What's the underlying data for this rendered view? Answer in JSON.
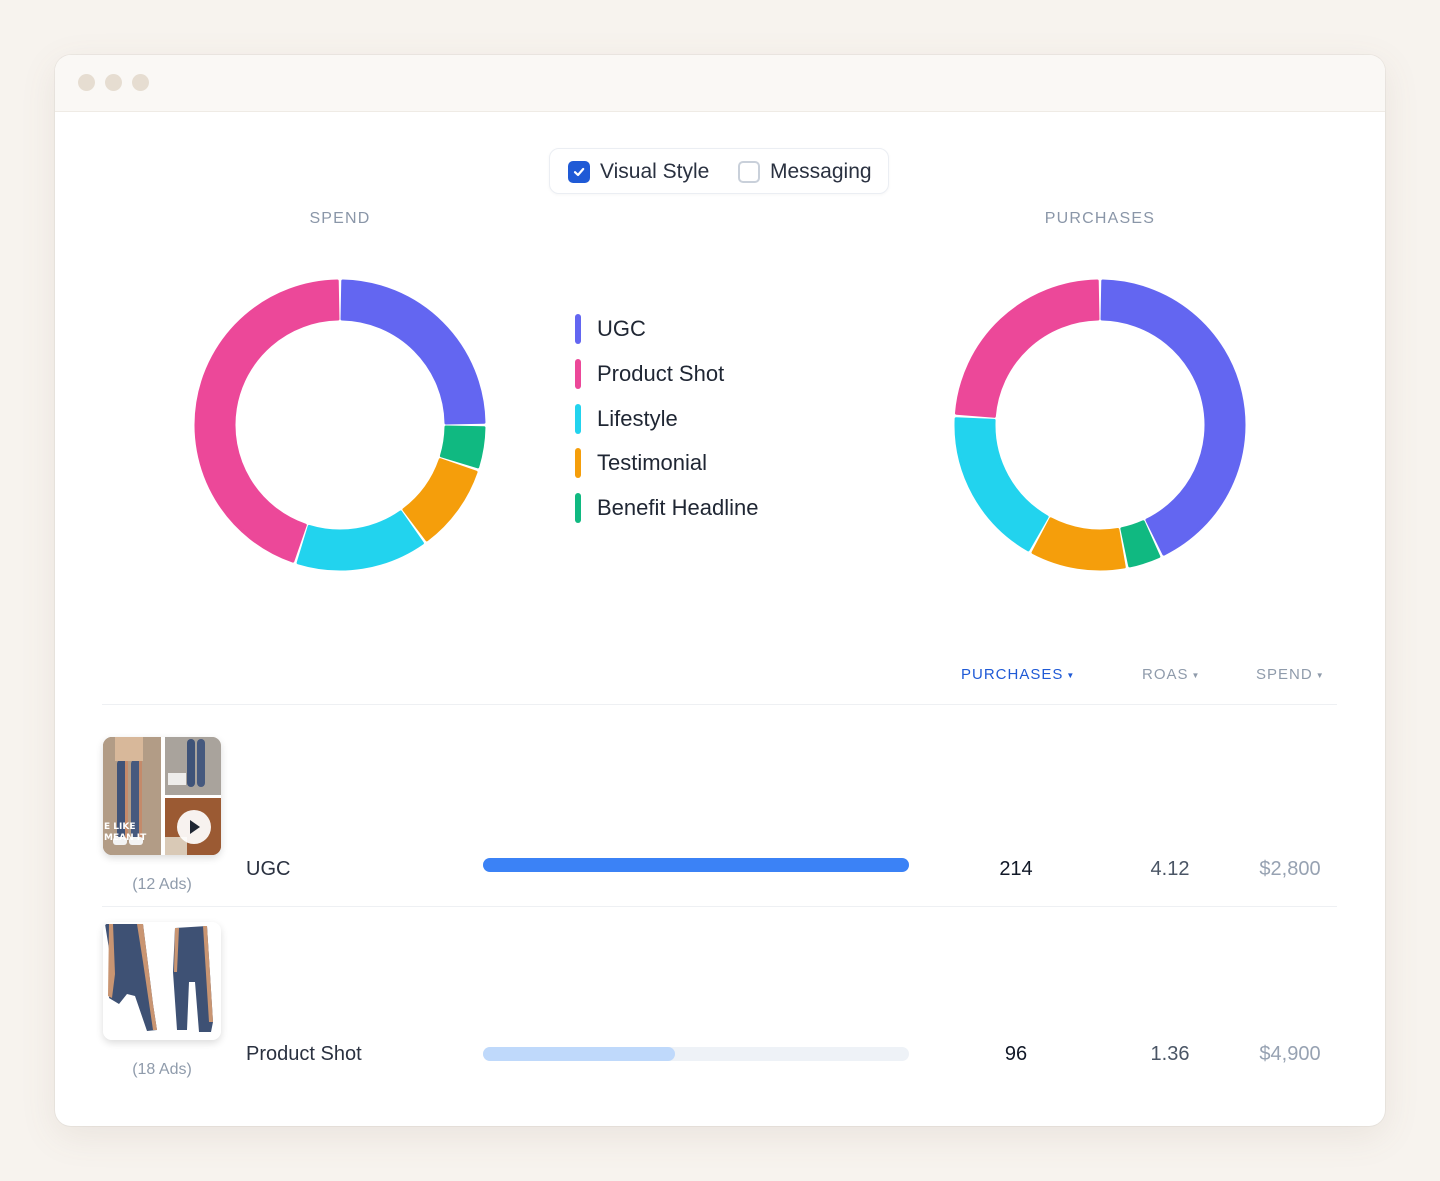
{
  "filters": [
    {
      "label": "Visual Style",
      "checked": true
    },
    {
      "label": "Messaging",
      "checked": false
    }
  ],
  "charts": {
    "spend_title": "SPEND",
    "purchases_title": "PURCHASES"
  },
  "legend": [
    {
      "label": "UGC",
      "color": "#6366f1"
    },
    {
      "label": "Product Shot",
      "color": "#ec4899"
    },
    {
      "label": "Lifestyle",
      "color": "#22d3ee"
    },
    {
      "label": "Testimonial",
      "color": "#f59e0b"
    },
    {
      "label": "Benefit Headline",
      "color": "#10b981"
    }
  ],
  "chart_data": [
    {
      "type": "pie",
      "title": "SPEND",
      "categories": [
        "UGC",
        "Benefit Headline",
        "Testimonial",
        "Lifestyle",
        "Product Shot"
      ],
      "values": [
        25,
        5,
        10,
        15,
        45
      ],
      "colors": [
        "#6366f1",
        "#10b981",
        "#f59e0b",
        "#22d3ee",
        "#ec4899"
      ],
      "style": "donut"
    },
    {
      "type": "pie",
      "title": "PURCHASES",
      "categories": [
        "UGC",
        "Benefit Headline",
        "Testimonial",
        "Lifestyle",
        "Product Shot"
      ],
      "values": [
        43,
        4,
        11,
        18,
        24
      ],
      "colors": [
        "#6366f1",
        "#10b981",
        "#f59e0b",
        "#22d3ee",
        "#ec4899"
      ],
      "style": "donut"
    }
  ],
  "table": {
    "columns": [
      {
        "label": "PURCHASES",
        "active": true
      },
      {
        "label": "ROAS",
        "active": false
      },
      {
        "label": "SPEND",
        "active": false
      }
    ],
    "rows": [
      {
        "label": "UGC",
        "ads": "(12 Ads)",
        "purchases": "214",
        "roas": "4.12",
        "spend": "$2,800",
        "bar_fraction": 1.0,
        "bar_color": "#3b82f6",
        "thumb_overlay": "E LIKE MEAN IT",
        "thumb_has_play": true
      },
      {
        "label": "Product Shot",
        "ads": "(18 Ads)",
        "purchases": "96",
        "roas": "1.36",
        "spend": "$4,900",
        "bar_fraction": 0.45,
        "bar_color": "#bfd9fb",
        "thumb_has_play": false
      }
    ]
  }
}
